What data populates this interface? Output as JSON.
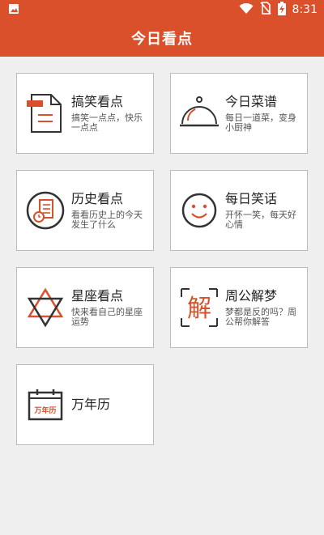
{
  "status_bar": {
    "time": "8:31",
    "icons": [
      "image-icon",
      "wifi-icon",
      "no-sim-icon",
      "battery-charging-icon"
    ]
  },
  "app_bar": {
    "title": "今日看点"
  },
  "colors": {
    "accent": "#d9502b",
    "icon_dark": "#333333"
  },
  "cards": [
    {
      "title": "搞笑看点",
      "subtitle": "搞笑一点点，快乐一点点",
      "icon": "funny-news-document-icon"
    },
    {
      "title": "今日菜谱",
      "subtitle": "每日一道菜，变身小厨神",
      "icon": "food-cloche-icon"
    },
    {
      "title": "历史看点",
      "subtitle": "看看历史上的今天发生了什么",
      "icon": "history-clock-document-icon"
    },
    {
      "title": "每日笑话",
      "subtitle": "开怀一笑，每天好心情",
      "icon": "smiley-face-icon"
    },
    {
      "title": "星座看点",
      "subtitle": "快来看自己的星座运势",
      "icon": "star-of-david-icon"
    },
    {
      "title": "周公解梦",
      "subtitle": "梦都是反的吗？周公帮你解答",
      "icon": "dream-jie-character-icon",
      "icon_text": "解"
    },
    {
      "title": "万年历",
      "icon": "calendar-icon",
      "icon_text": "万年历"
    }
  ]
}
